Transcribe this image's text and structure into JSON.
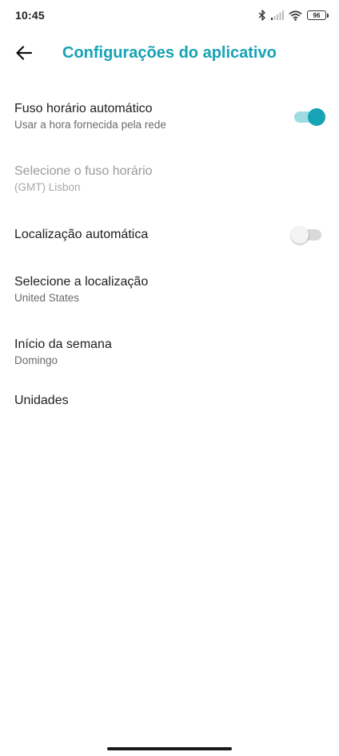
{
  "status_bar": {
    "time": "10:45",
    "battery": "96",
    "icons": [
      "bluetooth-icon",
      "signal-icon",
      "wifi-icon",
      "battery-icon"
    ]
  },
  "header": {
    "title": "Configurações do aplicativo",
    "back_icon": "arrow-left-icon",
    "accent_color": "#16a3b4"
  },
  "settings": {
    "auto_timezone": {
      "title": "Fuso horário automático",
      "subtitle": "Usar a hora fornecida pela rede",
      "enabled": true
    },
    "select_timezone": {
      "title": "Selecione o fuso horário",
      "subtitle": "(GMT) Lisbon",
      "disabled": true
    },
    "auto_location": {
      "title": "Localização automática",
      "enabled": false
    },
    "select_location": {
      "title": "Selecione a localização",
      "subtitle": "United States"
    },
    "week_start": {
      "title": "Início da semana",
      "subtitle": "Domingo"
    },
    "units": {
      "title": "Unidades"
    }
  }
}
